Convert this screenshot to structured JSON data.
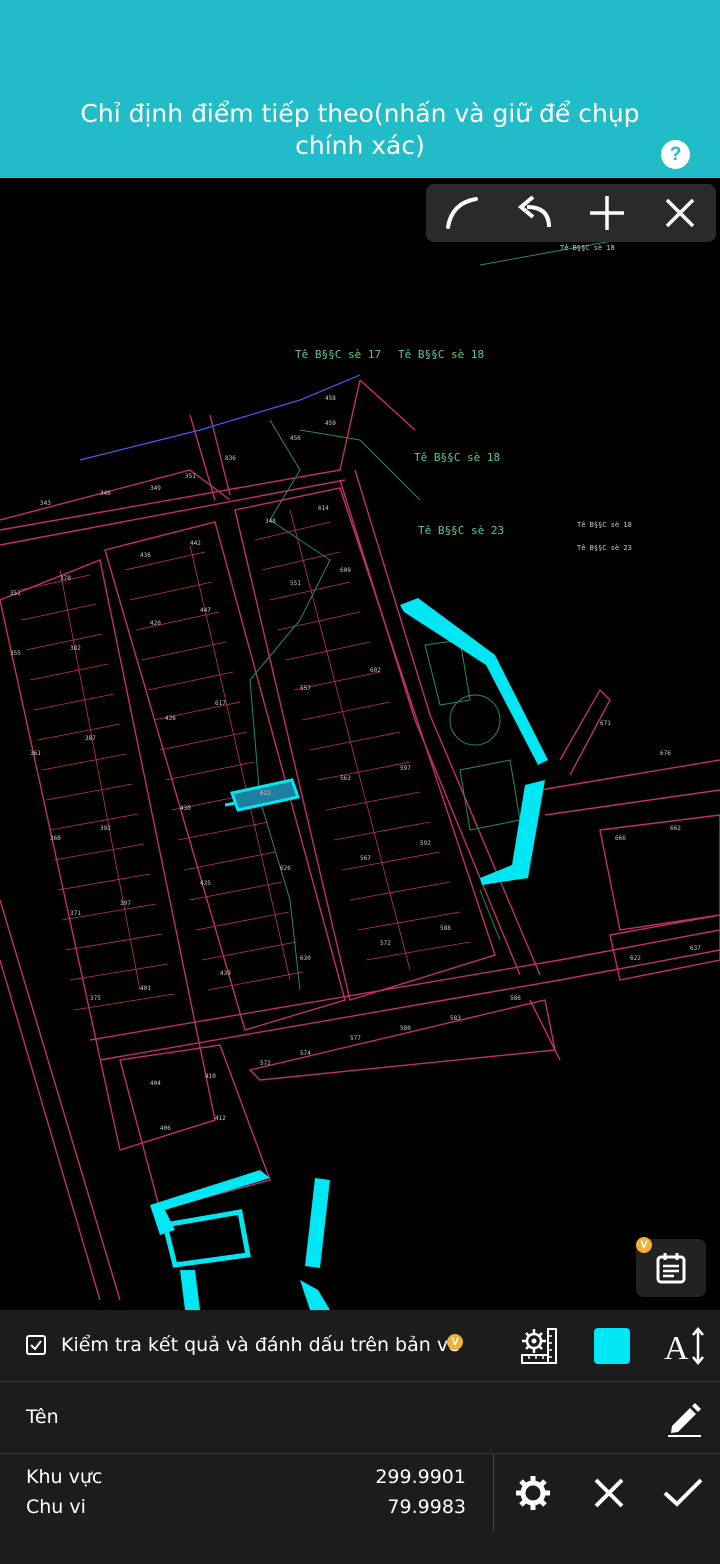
{
  "header": {
    "title": "Chỉ định điểm tiếp theo(nhấn và giữ để chụp chính xác)",
    "help_icon": "help-circle-icon",
    "help_glyph": "?"
  },
  "toolbar": {
    "arc_icon": "arc-icon",
    "undo_icon": "undo-icon",
    "add_icon": "plus-icon",
    "close_icon": "close-icon"
  },
  "map_labels": {
    "l1": "Tê B§§C sè 18",
    "l2": "Tê B§§C sè 17",
    "l3": "Tê B§§C sè 18",
    "l4": "Tê B§§C sè 18",
    "l5": "Tê B§§C sè 23",
    "l6": "Tê B§§C sè 18",
    "l7": "Tê B§§C sè 23"
  },
  "badge": "V",
  "options": {
    "check_label": "Kiểm tra kết quả và đánh dấu trên bản vẽ",
    "checked": true,
    "color": "#00e7f4"
  },
  "name_row": {
    "label": "Tên"
  },
  "stats": {
    "area_label": "Khu vực",
    "area_value": "299.9901",
    "perimeter_label": "Chu vi",
    "perimeter_value": "79.9983"
  },
  "colors": {
    "header_bg": "#22bcc8",
    "accent": "#00e7f4",
    "cad_lines": "#c0306a",
    "panel_bg": "#1c1c1c"
  }
}
